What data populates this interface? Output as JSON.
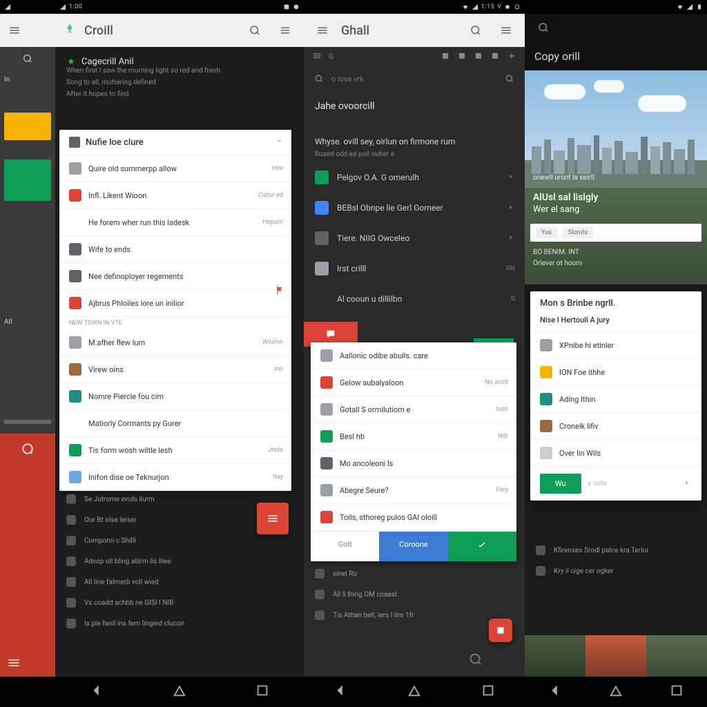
{
  "statusbar": {
    "time_left": "1:00",
    "time_right": "1:15",
    "carrier": "V"
  },
  "panel0": {
    "search_placeholder": "",
    "sidebar_items": [
      "In",
      "All"
    ]
  },
  "panel1": {
    "app_title": "Croill",
    "category_title": "Cagecrill Anil",
    "category_sub1": "When first I saw the morning light so red and fresh",
    "category_sub2": "Song to all, muttering defined",
    "category_sub3": "After it hopes to find",
    "card_header": "Nufie loe clure",
    "list": [
      {
        "label": "Quire old summerpp allow",
        "meta": "Hire",
        "color": "#9aa0a6"
      },
      {
        "label": "Infl. Likent Wioon",
        "meta": "Cubur ed",
        "color": "#db4437"
      },
      {
        "label": "He forem wher run this ladesk",
        "meta": "Hopum",
        "color": ""
      },
      {
        "label": "Wife to ends",
        "meta": "",
        "color": "#5f6368"
      },
      {
        "label": "Nee definoployer regements",
        "meta": "",
        "color": "#5f6368"
      },
      {
        "label": "Ajbrus Phloiles lore un inilior",
        "meta": "",
        "color": "#db4437"
      }
    ],
    "subheader1": "NEW TOWN IN VTE",
    "list2": [
      {
        "label": "M.afher flew lum",
        "meta": "Wilsmn",
        "color": "#9aa0a6"
      },
      {
        "label": "Virew oins",
        "meta": "Inn",
        "color": "#a06a3f"
      },
      {
        "label": "Nomre Piercle fou cim",
        "meta": "",
        "color": "#1e8e7e"
      },
      {
        "label": "Matiorly Cormants py Gurer",
        "meta": "",
        "color": ""
      },
      {
        "label": "Tis form wosh wiltle lesh",
        "meta": "Jnuls",
        "color": "#0f9d58"
      },
      {
        "label": "Inifon dise oe Teknurjon",
        "meta": "Itay",
        "color": "#6aa9e0"
      }
    ],
    "below": [
      "Se Jutrome evuls ilurm",
      "Our Bt olse lersei",
      "Componn c Shilll",
      "Advop oll bling allirm lis lliee",
      "All line falmerb voll wied",
      "Vs coadd achbb ne GISI I NIB",
      "Is pie fanil ins fern lingied clucon"
    ]
  },
  "panel2": {
    "app_title": "Ghall",
    "search_ph": "o lose vrk",
    "section1": "Jahe ovoorcill",
    "section1_body": "Whyse. ovill sey, oirlun on firmone rum",
    "section1_sub": "Bused odd ea poil outier e",
    "dlist": [
      {
        "label": "Pelgov O.A. G omerulh",
        "meta": "",
        "color": "#0f9d58"
      },
      {
        "label": "BEBsl Obnpe lie Gerl Gomeer",
        "meta": "",
        "color": "#4285f4"
      },
      {
        "label": "Tiere. NIIG Owceleo",
        "meta": "",
        "color": "#5f6368"
      },
      {
        "label": "Irst crilll",
        "meta": "Ols",
        "color": "#9aa0a6"
      },
      {
        "label": "Al cooun u dillilbn",
        "meta": "G",
        "color": ""
      }
    ],
    "card_header": "Aallonic odibe abuils. care",
    "clist": [
      {
        "label": "Gelow aubalyaloon",
        "meta": "No acird",
        "color": "#db4437"
      },
      {
        "label": "Gotall S ormilutiom e",
        "meta": "tusn",
        "color": "#9aa0a6"
      },
      {
        "label": "Besl hb",
        "meta": "Ndr",
        "color": "#0f9d58"
      },
      {
        "label": "Mo ancoleoni ls",
        "meta": "",
        "color": "#5f6368"
      },
      {
        "label": "Abegre Seure?",
        "meta": "Fory",
        "color": "#9aa0a6"
      },
      {
        "label": "Toils, sthoreg pulos GAl oloill",
        "meta": "",
        "color": "#db4437"
      }
    ],
    "actions": {
      "a": "Golt",
      "b": "Coroone",
      "c": ""
    },
    "below": [
      "sinel Ru",
      "All li lhing OM cnaeal",
      "Tis Athan bell, lers I lim 1fr"
    ]
  },
  "panel3": {
    "app_title": "Copy orill",
    "hero_sub": "onewll uront la seirll",
    "hero_title1": "AlUsl sal lislgly",
    "hero_title2": "Wer el sang",
    "badges": [
      "Yus",
      "Sloruts"
    ],
    "grey1": "BO BENIM. INT",
    "grey2": "Orlever ot hourn",
    "card_header": "Mon s Brinbe ngrll.",
    "card_sub": "Nise l Hertoull A jury",
    "plist": [
      {
        "label": "XPnibe hi etinler",
        "color": "#9aa0a6"
      },
      {
        "label": "ION Foe ithhe",
        "color": "#f5b400"
      },
      {
        "label": "Ading Ithin",
        "color": "#1e8e7e"
      },
      {
        "label": "Cronelk lifiv",
        "color": "#a06a3f"
      },
      {
        "label": "Over lin Wils",
        "color": "#ccc"
      }
    ],
    "cta": "Wu",
    "cta_side": "y note",
    "below": [
      "Kfirenses Srodl palce kra Terlor",
      "Kry il cige cer ogker"
    ]
  }
}
